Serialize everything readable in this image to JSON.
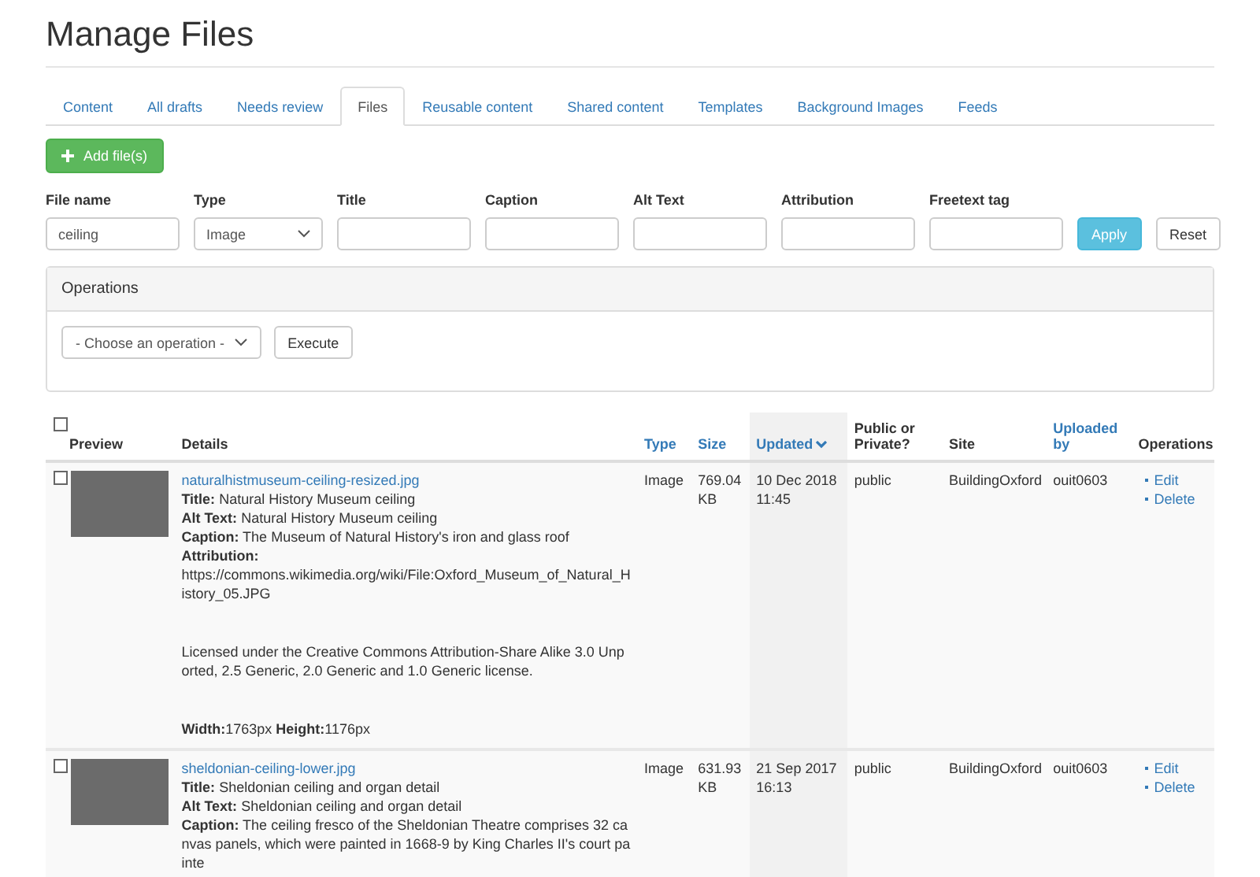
{
  "page_title": "Manage Files",
  "tabs": [
    {
      "label": "Content",
      "selected": false
    },
    {
      "label": "All drafts",
      "selected": false
    },
    {
      "label": "Needs review",
      "selected": false
    },
    {
      "label": "Files",
      "selected": true
    },
    {
      "label": "Reusable content",
      "selected": false
    },
    {
      "label": "Shared content",
      "selected": false
    },
    {
      "label": "Templates",
      "selected": false
    },
    {
      "label": "Background Images",
      "selected": false
    },
    {
      "label": "Feeds",
      "selected": false
    }
  ],
  "add_button": "Add file(s)",
  "filters": [
    {
      "label": "File name",
      "kind": "text",
      "value": "ceiling"
    },
    {
      "label": "Type",
      "kind": "select",
      "value": "Image"
    },
    {
      "label": "Title",
      "kind": "text"
    },
    {
      "label": "Caption",
      "kind": "text"
    },
    {
      "label": "Alt Text",
      "kind": "text"
    },
    {
      "label": "Attribution",
      "kind": "text"
    },
    {
      "label": "Freetext tag",
      "kind": "text"
    }
  ],
  "apply_button": "Apply",
  "reset_button": "Reset",
  "operations_panel": {
    "title": "Operations",
    "select": "- Choose an operation -",
    "execute_button": "Execute"
  },
  "table": {
    "select_all_checked": false,
    "columns": [
      {
        "label": "Preview",
        "sortable": false,
        "sorted": false
      },
      {
        "label": "Details",
        "sortable": false,
        "sorted": false
      },
      {
        "label": "Type",
        "sortable": true,
        "sorted": false
      },
      {
        "label": "Size",
        "sortable": true,
        "sorted": false
      },
      {
        "label": "Updated",
        "sortable": true,
        "sorted": true
      },
      {
        "label": "Public or Private?",
        "sortable": false,
        "sorted": false
      },
      {
        "label": "Site",
        "sortable": false,
        "sorted": false
      },
      {
        "label": "Uploaded by",
        "sortable": true,
        "sorted": false
      },
      {
        "label": "Operations",
        "sortable": false,
        "sorted": false
      }
    ],
    "rows": [
      {
        "checked": false,
        "file_name": "naturalhistmuseum-ceiling-resized.jpg",
        "details": [
          {
            "kind": "line",
            "text": "**Title:** Natural History Museum ceiling"
          },
          {
            "kind": "line",
            "text": "**Alt Text:** Natural History Museum ceiling"
          },
          {
            "kind": "line",
            "text": "**Caption:** The Museum of Natural History's iron and glass roof"
          },
          {
            "kind": "line",
            "text": "**Attribution:**"
          },
          {
            "kind": "line",
            "text": "https://commons.wikimedia.org/wiki/File:Oxford_Museum_of_Natural_History_05.JPG"
          },
          {
            "kind": "spaced",
            "text": "Licensed under the Creative Commons Attribution-Share Alike 3.0 Unported, 2.5 Generic, 2.0 Generic and 1.0 Generic license."
          },
          {
            "kind": "spaced",
            "text": "**Width:**1763px **Height:**1176px"
          }
        ],
        "type": "Image",
        "size": "769.04 KB",
        "updated": "10 Dec 2018 11:45",
        "visibility": "public",
        "site": "BuildingOxford",
        "uploaded_by": "ouit0603",
        "operations": [
          "Edit",
          "Delete"
        ]
      },
      {
        "checked": false,
        "file_name": "sheldonian-ceiling-lower.jpg",
        "details": [
          {
            "kind": "line",
            "text": "**Title:** Sheldonian ceiling and organ detail"
          },
          {
            "kind": "line",
            "text": "**Alt Text:** Sheldonian ceiling and organ detail"
          },
          {
            "kind": "line",
            "text": "**Caption:** The ceiling fresco of the Sheldonian Theatre comprises 32 canvas panels, which were painted in 1668-9 by King Charles II's court painte"
          }
        ],
        "type": "Image",
        "size": "631.93 KB",
        "updated": "21 Sep 2017 16:13",
        "visibility": "public",
        "site": "BuildingOxford",
        "uploaded_by": "ouit0603",
        "operations": [
          "Edit",
          "Delete"
        ]
      }
    ]
  }
}
